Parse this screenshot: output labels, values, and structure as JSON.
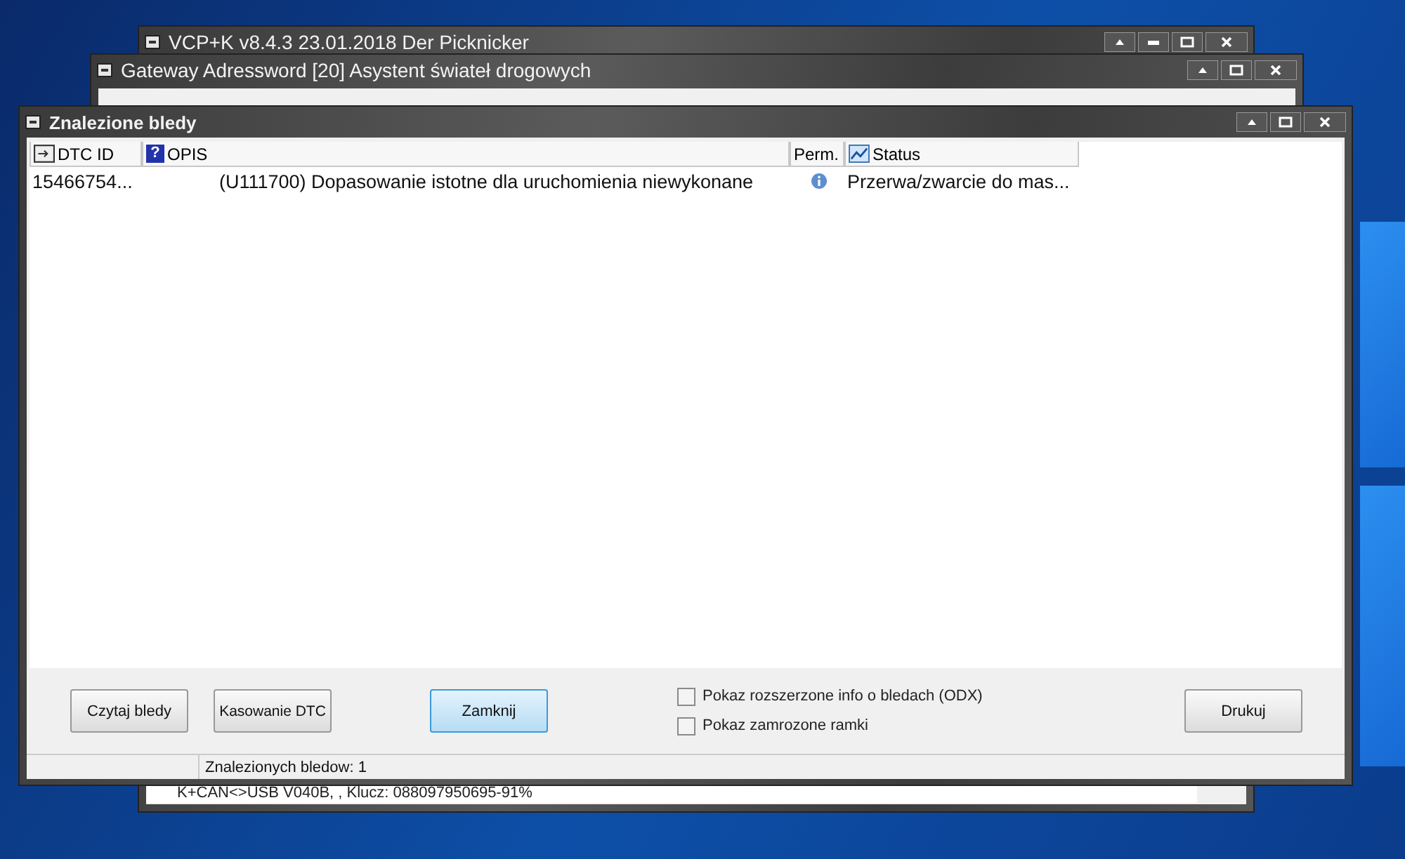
{
  "background_windows": [
    {
      "title": "VCP+K v8.4.3 23.01.2018 Der Picknicker",
      "status_text": "K+CAN<>USB V040B, , Klucz: 088097950695-91%"
    },
    {
      "title": "Gateway Adressword [20] Asystent świateł drogowych"
    }
  ],
  "window": {
    "title": "Znalezione bledy"
  },
  "table": {
    "columns": [
      {
        "label": "DTC ID",
        "kind": "id"
      },
      {
        "label": "OPIS",
        "kind": "help",
        "icon": "?"
      },
      {
        "label": "Perm.",
        "kind": "plain"
      },
      {
        "label": "Status",
        "kind": "chart"
      }
    ],
    "rows": [
      {
        "dtc_id": "15466754...",
        "opis": "(U111700) Dopasowanie istotne dla uruchomienia niewykonane",
        "perm_info": true,
        "status": "Przerwa/zwarcie do mas..."
      }
    ]
  },
  "buttons": [
    {
      "label": "Czytaj bledy",
      "selected": false
    },
    {
      "label": "Kasowanie DTC",
      "selected": false
    },
    {
      "label": "Zamknij",
      "selected": true
    }
  ],
  "checkboxes": [
    {
      "label": "Pokaz rozszerzone info o bledach (ODX)",
      "checked": false
    },
    {
      "label": "Pokaz zamrozone ramki",
      "checked": false
    }
  ],
  "print_button": {
    "label": "Drukuj"
  },
  "status_bar": {
    "text": "Znalezionych bledow: 1"
  }
}
